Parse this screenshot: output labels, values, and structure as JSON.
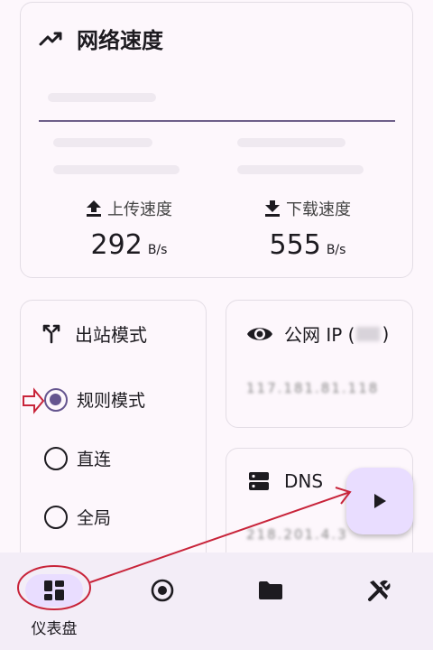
{
  "speed_card": {
    "title": "网络速度",
    "upload_label": "上传速度",
    "upload_value": "292",
    "upload_unit": "B/s",
    "download_label": "下载速度",
    "download_value": "555",
    "download_unit": "B/s"
  },
  "mode_card": {
    "title": "出站模式",
    "options": [
      {
        "label": "规则模式",
        "selected": true
      },
      {
        "label": "直连",
        "selected": false
      },
      {
        "label": "全局",
        "selected": false
      }
    ]
  },
  "ip_card": {
    "title": "公网 IP (",
    "title_end": ")",
    "value": "117.181.81.118"
  },
  "dns_card": {
    "title": "DNS",
    "value": "218.201.4.3"
  },
  "fab": {
    "icon": "play-icon"
  },
  "bottom_nav": {
    "items": [
      {
        "icon": "dashboard-icon",
        "label": "仪表盘",
        "active": true
      },
      {
        "icon": "target-icon",
        "label": "",
        "active": false
      },
      {
        "icon": "folder-icon",
        "label": "",
        "active": false
      },
      {
        "icon": "tools-icon",
        "label": "",
        "active": false
      }
    ]
  },
  "colors": {
    "accent": "#65558f",
    "annotation": "#c8243a",
    "nav_background": "#f3edf7",
    "active_pill": "#e9ddff"
  }
}
